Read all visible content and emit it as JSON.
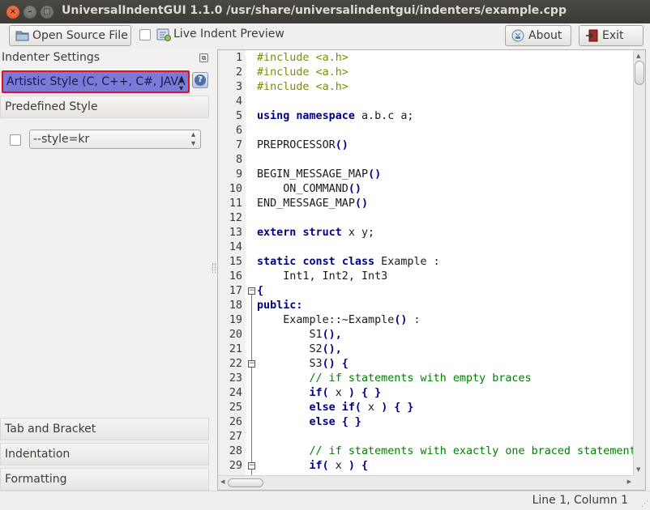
{
  "window": {
    "title": "UniversalIndentGUI 1.1.0 /usr/share/universalindentgui/indenters/example.cpp",
    "close_glyph": "×",
    "min_glyph": "–",
    "max_glyph": "□"
  },
  "toolbar": {
    "open_label": "Open Source File",
    "live_preview_label": "Live Indent Preview",
    "live_preview_checked": false,
    "about_label": "About",
    "exit_label": "Exit"
  },
  "left": {
    "settings_title": "Indenter Settings",
    "indenter_selected": "Artistic Style (C, C++, C#, JAVA",
    "help_glyph": "?",
    "predefined_title": "Predefined Style",
    "predefined_checked": false,
    "predefined_value": "--style=kr",
    "sections": [
      "Tab and Bracket",
      "Indentation",
      "Formatting"
    ]
  },
  "editor": {
    "lines": [
      {
        "n": "1",
        "parts": [
          {
            "t": "#include <a.h>",
            "c": "pp"
          }
        ]
      },
      {
        "n": "2",
        "parts": [
          {
            "t": "#include <a.h>",
            "c": "pp"
          }
        ]
      },
      {
        "n": "3",
        "parts": [
          {
            "t": "#include <a.h>",
            "c": "pp"
          }
        ]
      },
      {
        "n": "4",
        "parts": []
      },
      {
        "n": "5",
        "parts": [
          {
            "t": "using",
            "c": "kw"
          },
          {
            "t": " "
          },
          {
            "t": "namespace",
            "c": "kw"
          },
          {
            "t": " a.b.c a;"
          }
        ]
      },
      {
        "n": "6",
        "parts": []
      },
      {
        "n": "7",
        "parts": [
          {
            "t": "PREPROCESSOR"
          },
          {
            "t": "()",
            "c": "kw"
          }
        ]
      },
      {
        "n": "8",
        "parts": []
      },
      {
        "n": "9",
        "parts": [
          {
            "t": "BEGIN_MESSAGE_MAP"
          },
          {
            "t": "()",
            "c": "kw"
          }
        ]
      },
      {
        "n": "10",
        "parts": [
          {
            "t": "    ON_COMMAND"
          },
          {
            "t": "()",
            "c": "kw"
          }
        ]
      },
      {
        "n": "11",
        "parts": [
          {
            "t": "END_MESSAGE_MAP"
          },
          {
            "t": "()",
            "c": "kw"
          }
        ]
      },
      {
        "n": "12",
        "parts": []
      },
      {
        "n": "13",
        "parts": [
          {
            "t": "extern",
            "c": "kw"
          },
          {
            "t": " "
          },
          {
            "t": "struct",
            "c": "kw"
          },
          {
            "t": " x y;"
          }
        ]
      },
      {
        "n": "14",
        "parts": []
      },
      {
        "n": "15",
        "parts": [
          {
            "t": "static",
            "c": "kw"
          },
          {
            "t": " "
          },
          {
            "t": "const",
            "c": "kw"
          },
          {
            "t": " "
          },
          {
            "t": "class",
            "c": "kw"
          },
          {
            "t": " Example :"
          }
        ]
      },
      {
        "n": "16",
        "parts": [
          {
            "t": "    Int1, Int2, Int3"
          }
        ]
      },
      {
        "n": "17",
        "parts": [
          {
            "t": "{",
            "c": "kw"
          }
        ],
        "fold": "box"
      },
      {
        "n": "18",
        "parts": [
          {
            "t": "public:",
            "c": "kw"
          }
        ]
      },
      {
        "n": "19",
        "parts": [
          {
            "t": "    Example::~Example"
          },
          {
            "t": "()",
            "c": "kw"
          },
          {
            "t": " :"
          }
        ]
      },
      {
        "n": "20",
        "parts": [
          {
            "t": "        S1"
          },
          {
            "t": "(),",
            "c": "kw"
          }
        ]
      },
      {
        "n": "21",
        "parts": [
          {
            "t": "        S2"
          },
          {
            "t": "(),",
            "c": "kw"
          }
        ]
      },
      {
        "n": "22",
        "parts": [
          {
            "t": "        S3"
          },
          {
            "t": "() {",
            "c": "kw"
          }
        ],
        "fold": "box"
      },
      {
        "n": "23",
        "parts": [
          {
            "t": "        // if statements with empty braces",
            "c": "cm"
          }
        ]
      },
      {
        "n": "24",
        "parts": [
          {
            "t": "        "
          },
          {
            "t": "if(",
            "c": "kw"
          },
          {
            "t": " x "
          },
          {
            "t": ") { }",
            "c": "kw"
          }
        ]
      },
      {
        "n": "25",
        "parts": [
          {
            "t": "        "
          },
          {
            "t": "else if(",
            "c": "kw"
          },
          {
            "t": " x "
          },
          {
            "t": ") { }",
            "c": "kw"
          }
        ]
      },
      {
        "n": "26",
        "parts": [
          {
            "t": "        "
          },
          {
            "t": "else { }",
            "c": "kw"
          }
        ]
      },
      {
        "n": "27",
        "parts": []
      },
      {
        "n": "28",
        "parts": [
          {
            "t": "        // if statements with exactly one braced statement",
            "c": "cm"
          }
        ]
      },
      {
        "n": "29",
        "parts": [
          {
            "t": "        "
          },
          {
            "t": "if(",
            "c": "kw"
          },
          {
            "t": " x "
          },
          {
            "t": ") {",
            "c": "kw"
          }
        ],
        "fold": "box"
      }
    ]
  },
  "status": {
    "position": "Line 1, Column 1"
  },
  "colors": {
    "selected_combo": "#7b7ad8",
    "selected_border": "#e0111e",
    "keyword": "#000080",
    "preprocessor": "#7d8b00",
    "comment": "#007f00"
  }
}
